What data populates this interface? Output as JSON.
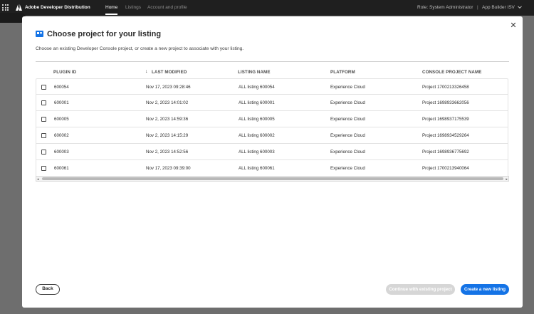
{
  "topbar": {
    "brand": "Adobe Developer Distribution",
    "nav": [
      "Home",
      "Listings",
      "Account and profile"
    ],
    "role": "Role: System Administrator",
    "separator": "|",
    "context": "App Builder ISV"
  },
  "modal": {
    "title": "Choose project for your listing",
    "subtitle": "Choose an existing Developer Console project, or create a new project to associate with your listing.",
    "close_icon": "close-icon",
    "table": {
      "columns": [
        "PLUGIN ID",
        "LAST MODIFIED",
        "LISTING NAME",
        "PLATFORM",
        "CONSOLE PROJECT NAME"
      ],
      "sort_icon": "arrow-down-icon",
      "rows": [
        {
          "plugin_id": "600054",
          "last_modified": "Nov 17, 2023 09:28:46",
          "listing_name": "ALL listing 600054",
          "platform": "Experience Cloud",
          "console_project": "Project 1700213326458"
        },
        {
          "plugin_id": "600001",
          "last_modified": "Nov 2, 2023 14:01:02",
          "listing_name": "ALL listing 600001",
          "platform": "Experience Cloud",
          "console_project": "Project 1698933662056"
        },
        {
          "plugin_id": "600005",
          "last_modified": "Nov 2, 2023 14:59:36",
          "listing_name": "ALL listing 600005",
          "platform": "Experience Cloud",
          "console_project": "Project 1698937175539"
        },
        {
          "plugin_id": "600002",
          "last_modified": "Nov 2, 2023 14:15:29",
          "listing_name": "ALL listing 600002",
          "platform": "Experience Cloud",
          "console_project": "Project 1698934529264"
        },
        {
          "plugin_id": "600003",
          "last_modified": "Nov 2, 2023 14:52:56",
          "listing_name": "ALL listing 600003",
          "platform": "Experience Cloud",
          "console_project": "Project 1698936775692"
        },
        {
          "plugin_id": "600061",
          "last_modified": "Nov 17, 2023 09:39:00",
          "listing_name": "ALL listing 600061",
          "platform": "Experience Cloud",
          "console_project": "Project 1700213940064"
        }
      ]
    },
    "buttons": {
      "back": "Back",
      "continue": "Continue with existing project",
      "create": "Create a new listing"
    }
  },
  "colors": {
    "accent": "#1473e6",
    "topbar": "#1f1f1f",
    "overlay": "#6e6e6e",
    "disabled": "#d6d6d6"
  }
}
